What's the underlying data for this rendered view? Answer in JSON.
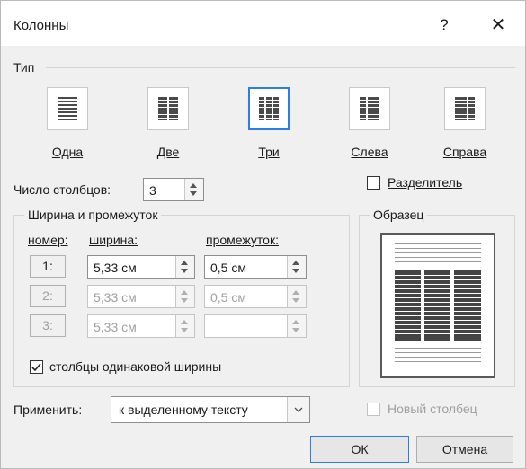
{
  "window": {
    "title": "Колонны",
    "help_label": "?",
    "close_label": "✕"
  },
  "type_section": {
    "label": "Тип",
    "presets": [
      {
        "label": "Одна",
        "selected": false
      },
      {
        "label": "Две",
        "selected": false
      },
      {
        "label": "Три",
        "selected": true
      },
      {
        "label": "Слева",
        "selected": false
      },
      {
        "label": "Справа",
        "selected": false
      }
    ]
  },
  "num_columns": {
    "label": "Число столбцов:",
    "value": "3"
  },
  "separator": {
    "label": "Разделитель",
    "checked": false
  },
  "width_spacing": {
    "label": "Ширина и промежуток",
    "col_number_header": "номер:",
    "width_header": "ширина:",
    "spacing_header": "промежуток:",
    "rows": [
      {
        "num": "1:",
        "width": "5,33 см",
        "spacing": "0,5 см",
        "enabled": true
      },
      {
        "num": "2:",
        "width": "5,33 см",
        "spacing": "0,5 см",
        "enabled": false
      },
      {
        "num": "3:",
        "width": "5,33 см",
        "spacing": "",
        "enabled": false
      }
    ]
  },
  "equal_width": {
    "label": "столбцы одинаковой ширины",
    "checked": true
  },
  "preview": {
    "label": "Образец"
  },
  "apply_to": {
    "label": "Применить:",
    "value": "к выделенному тексту"
  },
  "new_column": {
    "label": "Новый столбец",
    "checked": false,
    "enabled": false
  },
  "buttons": {
    "ok": "ОК",
    "cancel": "Отмена"
  },
  "colors": {
    "accent": "#2b7de9",
    "disabled_text": "#a0a0a0"
  }
}
